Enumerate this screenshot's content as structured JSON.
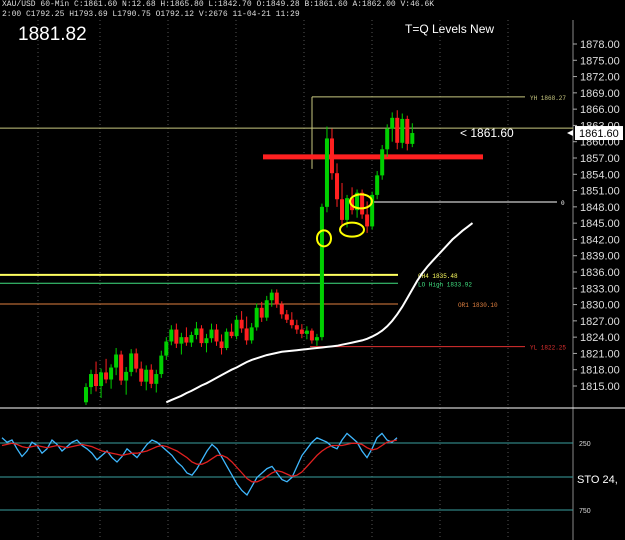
{
  "header": {
    "line1": "XAU/USD 60-Min  C:1861.60  N:12.68  H:1865.80  L:1842.70  O:1849.28  B:1861.60  A:1862.00  V:46.6K",
    "line2": "2:00  C1792.25  H1793.69  L1790.75  O1792.12  V:2676  11-04-21  11:29"
  },
  "big_price": "1881.82",
  "chart_title": "T=Q Levels New",
  "current_label": "< 1861.60",
  "price_axis": {
    "ticks": [
      "1878.00",
      "1875.00",
      "1872.00",
      "1869.00",
      "1866.00",
      "1863.00",
      "1860.00",
      "1857.00",
      "1854.00",
      "1851.00",
      "1848.00",
      "1845.00",
      "1842.00",
      "1839.00",
      "1836.00",
      "1833.00",
      "1830.00",
      "1827.00",
      "1824.00",
      "1821.00",
      "1818.00",
      "1815.00"
    ],
    "current": "1861.60"
  },
  "stoch_axis": {
    "label": "STO  24,",
    "ticks": [
      "250",
      "750"
    ]
  },
  "colors": {
    "up": "#00d000",
    "down": "#ff2020",
    "resistance": "#ff2020",
    "ema": "#ffffff",
    "k_line": "#3fb8ff",
    "d_line": "#e02020"
  },
  "chart_data": {
    "type": "candlestick",
    "title": "T=Q Levels New",
    "symbol": "XAU/USD",
    "timeframe": "60-Min",
    "ylim": [
      1812,
      1881
    ],
    "levels": [
      {
        "label": "YH 1868.27",
        "value": 1868.27,
        "color": "#c8c880"
      },
      {
        "label": "",
        "value": 1862.5,
        "color": "#c8c880"
      },
      {
        "label": "",
        "value": 1857.2,
        "color": "#ff2020"
      },
      {
        "label": "0",
        "value": 1848.9,
        "color": "#ffffff"
      },
      {
        "label": "0H4 1835.48",
        "value": 1835.48,
        "color": "#ffff60"
      },
      {
        "label": "LO High 1833.92",
        "value": 1833.92,
        "color": "#40e080"
      },
      {
        "label": "OR1 1830.10",
        "value": 1830.1,
        "color": "#e08040"
      },
      {
        "label": "YL 1822.25",
        "value": 1822.25,
        "color": "#e03030"
      }
    ],
    "candles": [
      [
        1812.0,
        1815.5,
        1811.5,
        1814.8
      ],
      [
        1814.8,
        1818.0,
        1813.5,
        1817.2
      ],
      [
        1817.2,
        1819.5,
        1814.0,
        1815.0
      ],
      [
        1815.0,
        1818.2,
        1812.8,
        1817.5
      ],
      [
        1817.5,
        1820.0,
        1815.5,
        1816.2
      ],
      [
        1816.2,
        1819.0,
        1814.5,
        1818.4
      ],
      [
        1818.4,
        1822.0,
        1817.0,
        1820.8
      ],
      [
        1820.8,
        1821.5,
        1815.2,
        1816.0
      ],
      [
        1816.0,
        1818.5,
        1813.4,
        1817.6
      ],
      [
        1817.6,
        1821.8,
        1816.8,
        1821.0
      ],
      [
        1821.0,
        1821.9,
        1817.5,
        1818.2
      ],
      [
        1818.2,
        1819.5,
        1815.0,
        1815.8
      ],
      [
        1815.8,
        1818.8,
        1814.2,
        1818.0
      ],
      [
        1818.0,
        1819.0,
        1814.6,
        1815.4
      ],
      [
        1815.4,
        1818.0,
        1813.8,
        1817.2
      ],
      [
        1817.2,
        1821.5,
        1816.5,
        1820.6
      ],
      [
        1820.6,
        1824.0,
        1819.8,
        1823.2
      ],
      [
        1823.2,
        1826.2,
        1822.5,
        1825.4
      ],
      [
        1825.4,
        1826.5,
        1822.0,
        1822.8
      ],
      [
        1822.8,
        1824.8,
        1820.8,
        1824.0
      ],
      [
        1824.0,
        1825.8,
        1822.4,
        1823.0
      ],
      [
        1823.0,
        1825.0,
        1822.2,
        1824.4
      ],
      [
        1824.4,
        1826.8,
        1823.6,
        1825.6
      ],
      [
        1825.6,
        1826.2,
        1822.2,
        1822.9
      ],
      [
        1822.9,
        1824.6,
        1821.2,
        1823.8
      ],
      [
        1823.8,
        1826.5,
        1823.0,
        1825.4
      ],
      [
        1825.4,
        1826.4,
        1822.4,
        1823.2
      ],
      [
        1823.2,
        1824.5,
        1820.8,
        1822.0
      ],
      [
        1822.0,
        1825.6,
        1821.6,
        1825.0
      ],
      [
        1825.0,
        1826.5,
        1823.8,
        1824.2
      ],
      [
        1824.2,
        1828.0,
        1823.6,
        1827.2
      ],
      [
        1827.2,
        1828.8,
        1824.8,
        1825.6
      ],
      [
        1825.6,
        1827.8,
        1822.6,
        1823.4
      ],
      [
        1823.4,
        1826.6,
        1822.8,
        1825.8
      ],
      [
        1825.8,
        1830.2,
        1825.2,
        1829.4
      ],
      [
        1829.4,
        1830.5,
        1826.8,
        1827.6
      ],
      [
        1827.6,
        1831.6,
        1827.0,
        1830.8
      ],
      [
        1830.8,
        1832.8,
        1829.6,
        1832.2
      ],
      [
        1832.2,
        1832.8,
        1829.4,
        1830.0
      ],
      [
        1830.0,
        1830.6,
        1827.4,
        1828.2
      ],
      [
        1828.2,
        1829.0,
        1826.6,
        1827.2
      ],
      [
        1827.2,
        1828.6,
        1825.6,
        1826.2
      ],
      [
        1826.2,
        1827.2,
        1824.6,
        1825.4
      ],
      [
        1825.4,
        1826.4,
        1823.8,
        1824.6
      ],
      [
        1824.6,
        1826.0,
        1823.6,
        1825.2
      ],
      [
        1825.2,
        1825.6,
        1822.8,
        1823.4
      ],
      [
        1823.4,
        1824.6,
        1822.4,
        1824.0
      ],
      [
        1824.0,
        1848.6,
        1823.4,
        1848.0
      ],
      [
        1848.0,
        1862.8,
        1847.0,
        1860.6
      ],
      [
        1860.6,
        1862.4,
        1853.0,
        1854.2
      ],
      [
        1854.2,
        1856.0,
        1848.0,
        1849.4
      ],
      [
        1849.4,
        1852.4,
        1844.6,
        1845.6
      ],
      [
        1845.6,
        1850.2,
        1844.2,
        1849.6
      ],
      [
        1849.6,
        1851.6,
        1846.6,
        1847.4
      ],
      [
        1847.4,
        1851.2,
        1846.0,
        1850.6
      ],
      [
        1850.6,
        1851.2,
        1845.8,
        1846.6
      ],
      [
        1846.6,
        1849.0,
        1843.2,
        1844.4
      ],
      [
        1844.4,
        1850.8,
        1843.8,
        1850.2
      ],
      [
        1850.2,
        1854.6,
        1849.4,
        1853.8
      ],
      [
        1853.8,
        1859.4,
        1853.0,
        1858.6
      ],
      [
        1858.6,
        1863.2,
        1857.2,
        1862.4
      ],
      [
        1862.4,
        1865.4,
        1860.0,
        1864.4
      ],
      [
        1864.4,
        1865.8,
        1858.6,
        1859.8
      ],
      [
        1859.8,
        1865.2,
        1858.8,
        1864.2
      ],
      [
        1864.2,
        1864.8,
        1858.4,
        1859.6
      ],
      [
        1859.6,
        1863.4,
        1859.0,
        1861.6
      ]
    ],
    "ema": [
      1812.0,
      1812.4,
      1812.8,
      1813.2,
      1813.7,
      1814.1,
      1814.6,
      1815.1,
      1815.5,
      1816.0,
      1816.5,
      1817.0,
      1817.5,
      1818.0,
      1818.4,
      1818.9,
      1819.4,
      1819.8,
      1820.1,
      1820.4,
      1820.7,
      1820.9,
      1821.1,
      1821.3,
      1821.4,
      1821.5,
      1821.6,
      1821.7,
      1821.8,
      1821.9,
      1822.0,
      1822.1,
      1822.2,
      1822.3,
      1822.4,
      1822.6,
      1822.8,
      1823.0,
      1823.2,
      1823.4,
      1823.7,
      1824.1,
      1824.6,
      1825.2,
      1826.0,
      1827.0,
      1828.2,
      1829.6,
      1831.2,
      1832.8,
      1834.4,
      1835.8,
      1837.0,
      1838.0,
      1839.0,
      1840.0,
      1841.0,
      1842.0,
      1842.8,
      1843.6,
      1844.3,
      1845.0
    ],
    "ema_offset": 16,
    "stoch_k": [
      62,
      58,
      60,
      52,
      45,
      50,
      58,
      55,
      48,
      52,
      60,
      56,
      50,
      54,
      58,
      60,
      55,
      52,
      48,
      42,
      46,
      50,
      44,
      40,
      45,
      52,
      48,
      44,
      50,
      56,
      60,
      58,
      54,
      50,
      46,
      40,
      36,
      30,
      28,
      34,
      42,
      50,
      56,
      52,
      44,
      36,
      28,
      20,
      14,
      10,
      18,
      26,
      30,
      34,
      36,
      30,
      24,
      22,
      26,
      36,
      46,
      52,
      58,
      62,
      60,
      58,
      54,
      52,
      60,
      66,
      62,
      58,
      50,
      44,
      52,
      62,
      66,
      60,
      58,
      62
    ],
    "stoch_d": [
      55,
      56,
      57,
      56,
      54,
      53,
      54,
      55,
      54,
      53,
      54,
      55,
      54,
      53,
      54,
      55,
      56,
      55,
      54,
      52,
      50,
      49,
      48,
      47,
      46,
      47,
      48,
      48,
      49,
      50,
      52,
      54,
      55,
      54,
      52,
      50,
      47,
      44,
      40,
      38,
      38,
      40,
      43,
      46,
      46,
      44,
      40,
      35,
      30,
      25,
      22,
      22,
      24,
      27,
      30,
      32,
      31,
      29,
      27,
      28,
      31,
      36,
      41,
      46,
      50,
      53,
      55,
      55,
      55,
      56,
      57,
      57,
      56,
      53,
      51,
      52,
      55,
      58,
      59,
      60
    ]
  }
}
